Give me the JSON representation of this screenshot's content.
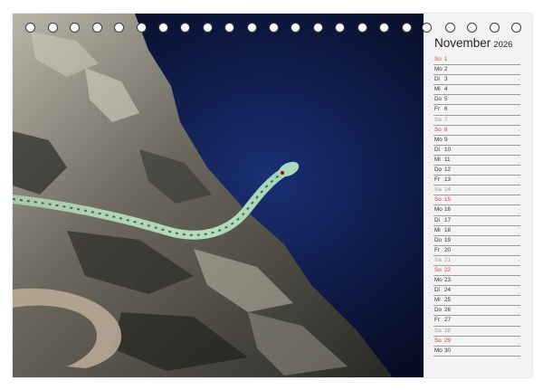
{
  "calendar": {
    "month": "November",
    "year": "2026",
    "days": [
      {
        "dn": "So",
        "dd": "1",
        "t": "sun"
      },
      {
        "dn": "Mo",
        "dd": "2",
        "t": "wk"
      },
      {
        "dn": "Di",
        "dd": "3",
        "t": "wk"
      },
      {
        "dn": "Mi",
        "dd": "4",
        "t": "wk"
      },
      {
        "dn": "Do",
        "dd": "5",
        "t": "wk"
      },
      {
        "dn": "Fr",
        "dd": "6",
        "t": "wk"
      },
      {
        "dn": "Sa",
        "dd": "7",
        "t": "sat"
      },
      {
        "dn": "So",
        "dd": "8",
        "t": "sun"
      },
      {
        "dn": "Mo",
        "dd": "9",
        "t": "wk"
      },
      {
        "dn": "Di",
        "dd": "10",
        "t": "wk"
      },
      {
        "dn": "Mi",
        "dd": "11",
        "t": "wk"
      },
      {
        "dn": "Do",
        "dd": "12",
        "t": "wk"
      },
      {
        "dn": "Fr",
        "dd": "13",
        "t": "wk"
      },
      {
        "dn": "Sa",
        "dd": "14",
        "t": "sat"
      },
      {
        "dn": "So",
        "dd": "15",
        "t": "sun"
      },
      {
        "dn": "Mo",
        "dd": "16",
        "t": "wk"
      },
      {
        "dn": "Di",
        "dd": "17",
        "t": "wk"
      },
      {
        "dn": "Mi",
        "dd": "18",
        "t": "wk"
      },
      {
        "dn": "Do",
        "dd": "19",
        "t": "wk"
      },
      {
        "dn": "Fr",
        "dd": "20",
        "t": "wk"
      },
      {
        "dn": "Sa",
        "dd": "21",
        "t": "sat"
      },
      {
        "dn": "So",
        "dd": "22",
        "t": "sun"
      },
      {
        "dn": "Mo",
        "dd": "23",
        "t": "wk"
      },
      {
        "dn": "Di",
        "dd": "24",
        "t": "wk"
      },
      {
        "dn": "Mi",
        "dd": "25",
        "t": "wk"
      },
      {
        "dn": "Do",
        "dd": "26",
        "t": "wk"
      },
      {
        "dn": "Fr",
        "dd": "27",
        "t": "wk"
      },
      {
        "dn": "Sa",
        "dd": "28",
        "t": "sat"
      },
      {
        "dn": "So",
        "dd": "29",
        "t": "sun"
      },
      {
        "dn": "Mo",
        "dd": "30",
        "t": "wk"
      }
    ]
  },
  "colors": {
    "sunday": "#d23a3a",
    "saturday": "#9a9a9a",
    "weekday": "#333333",
    "panel": "#f3f3f3"
  },
  "binding": {
    "icon": "spiral-binding-hole"
  }
}
